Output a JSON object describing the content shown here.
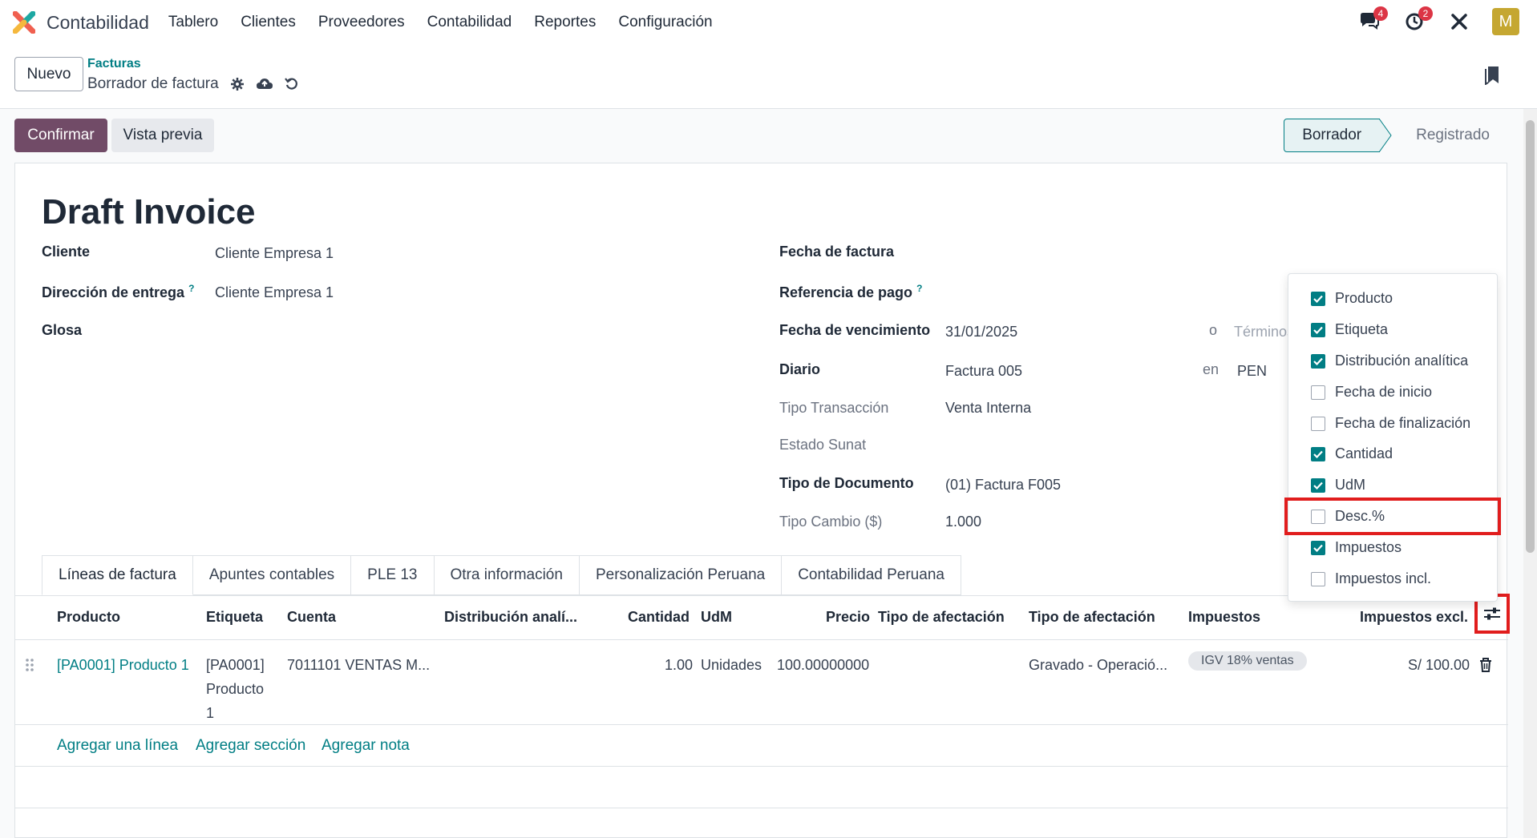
{
  "topbar": {
    "app_title": "Contabilidad",
    "menu": [
      "Tablero",
      "Clientes",
      "Proveedores",
      "Contabilidad",
      "Reportes",
      "Configuración"
    ],
    "messages_count": "4",
    "activities_count": "2",
    "avatar_letter": "M"
  },
  "control": {
    "new_label": "Nuevo",
    "breadcrumb_parent": "Facturas",
    "breadcrumb_current": "Borrador de factura"
  },
  "actions": {
    "confirm_label": "Confirmar",
    "preview_label": "Vista previa",
    "status_current": "Borrador",
    "status_next": "Registrado"
  },
  "form": {
    "title": "Draft Invoice",
    "cliente_label": "Cliente",
    "cliente_value": "Cliente Empresa 1",
    "direccion_label": "Dirección de entrega",
    "direccion_value": "Cliente Empresa 1",
    "glosa_label": "Glosa",
    "fecha_factura_label": "Fecha de factura",
    "referencia_label": "Referencia de pago",
    "vencimiento_label": "Fecha de vencimiento",
    "vencimiento_value": "31/01/2025",
    "o_label": "o",
    "termino_placeholder": "Términos",
    "diario_label": "Diario",
    "diario_value": "Factura 005",
    "en_label": "en",
    "moneda_value": "PEN",
    "tipo_transaccion_label": "Tipo Transacción",
    "tipo_transaccion_value": "Venta Interna",
    "estado_sunat_label": "Estado Sunat",
    "tipo_documento_label": "Tipo de Documento",
    "tipo_documento_value": "(01) Factura F005",
    "tipo_cambio_label": "Tipo Cambio ($)",
    "tipo_cambio_value": "1.000",
    "help_mark": "?"
  },
  "tabs": [
    "Líneas de factura",
    "Apuntes contables",
    "PLE 13",
    "Otra información",
    "Personalización Peruana",
    "Contabilidad Peruana"
  ],
  "table": {
    "headers": {
      "producto": "Producto",
      "etiqueta": "Etiqueta",
      "cuenta": "Cuenta",
      "distribucion": "Distribución analí...",
      "cantidad": "Cantidad",
      "udm": "UdM",
      "precio": "Precio",
      "tipo_afectacion_1": "Tipo de afectación",
      "tipo_afectacion_2": "Tipo de afectación",
      "impuestos": "Impuestos",
      "impuestos_excl": "Impuestos excl."
    },
    "row": {
      "producto": "[PA0001] Producto 1",
      "etiqueta_1": "[PA0001]",
      "etiqueta_2": "Producto",
      "etiqueta_3": "1",
      "cuenta": "7011101 VENTAS M...",
      "cantidad": "1.00",
      "udm": "Unidades",
      "precio": "100.00000000",
      "tipo_afectacion": "Gravado - Operació...",
      "impuesto": "IGV 18% ventas",
      "subtotal": "S/ 100.00"
    },
    "add_line": "Agregar una línea",
    "add_section": "Agregar sección",
    "add_note": "Agregar nota"
  },
  "columns_dropdown": {
    "items": [
      {
        "label": "Producto",
        "checked": true
      },
      {
        "label": "Etiqueta",
        "checked": true
      },
      {
        "label": "Distribución analítica",
        "checked": true
      },
      {
        "label": "Fecha de inicio",
        "checked": false
      },
      {
        "label": "Fecha de finalización",
        "checked": false
      },
      {
        "label": "Cantidad",
        "checked": true
      },
      {
        "label": "UdM",
        "checked": true
      },
      {
        "label": "Desc.%",
        "checked": false
      },
      {
        "label": "Impuestos",
        "checked": true
      },
      {
        "label": "Impuestos incl.",
        "checked": false
      }
    ]
  },
  "colors": {
    "primary": "#714b67",
    "link": "#017e84",
    "highlight": "#e11d1d"
  }
}
